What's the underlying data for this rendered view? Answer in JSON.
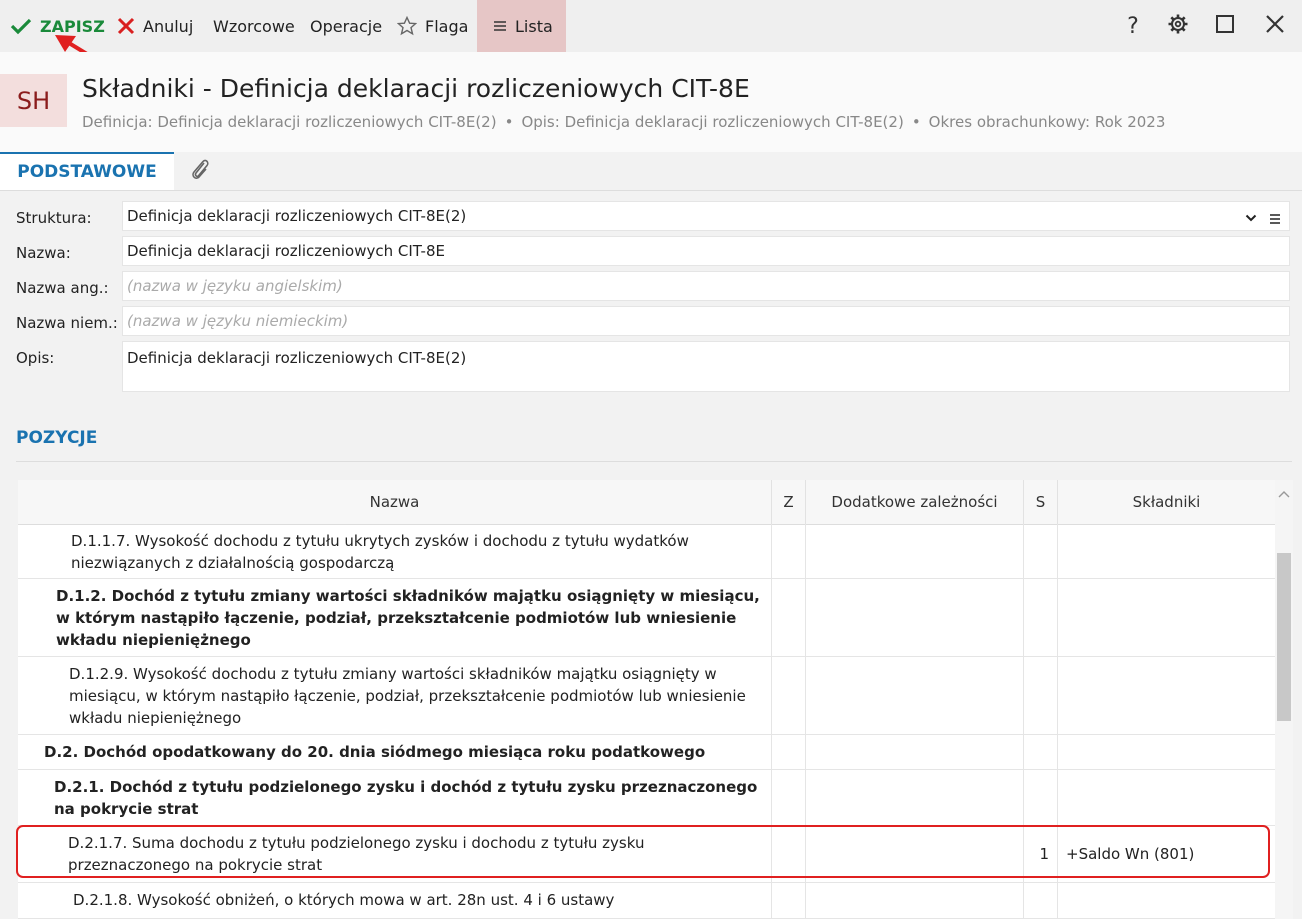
{
  "toolbar": {
    "save_label": "ZAPISZ",
    "cancel_label": "Anuluj",
    "templates_label": "Wzorcowe",
    "operations_label": "Operacje",
    "flag_label": "Flaga",
    "list_label": "Lista",
    "help_label": "?"
  },
  "header": {
    "avatar_text": "SH",
    "title": "Składniki - Definicja deklaracji rozliczeniowych CIT-8E",
    "subtitle": {
      "definition": "Definicja: Definicja deklaracji rozliczeniowych CIT-8E(2)",
      "description": "Opis: Definicja deklaracji rozliczeniowych CIT-8E(2)",
      "period": "Okres obrachunkowy: Rok 2023",
      "separator": "•"
    }
  },
  "tabs": {
    "main": "PODSTAWOWE"
  },
  "form": {
    "structure": {
      "label": "Struktura:",
      "value": "Definicja deklaracji rozliczeniowych CIT-8E(2)"
    },
    "name": {
      "label": "Nazwa:",
      "value": "Definicja deklaracji rozliczeniowych CIT-8E"
    },
    "name_en": {
      "label": "Nazwa ang.:",
      "placeholder": "(nazwa w języku angielskim)"
    },
    "name_de": {
      "label": "Nazwa niem.:",
      "placeholder": "(nazwa w języku niemieckim)"
    },
    "description": {
      "label": "Opis:",
      "value": "Definicja deklaracji rozliczeniowych CIT-8E(2)"
    }
  },
  "positions": {
    "title": "POZYCJE",
    "columns": [
      "Nazwa",
      "Z",
      "Dodatkowe zależności",
      "S",
      "Składniki"
    ],
    "rows": [
      {
        "name": "D.1.1.7. Wysokość dochodu z tytułu ukrytych zysków i dochodu z tytułu wydatków niezwiązanych z działalnością gospodarczą",
        "bold": false,
        "indent": 2,
        "s": "",
        "components": ""
      },
      {
        "name": "D.1.2. Dochód z tytułu zmiany wartości składników majątku osiągnięty w miesiącu, w którym nastąpiło łączenie, podział, przekształcenie podmiotów lub wniesienie wkładu niepieniężnego",
        "bold": true,
        "indent": 1,
        "s": "",
        "components": ""
      },
      {
        "name": "D.1.2.9. Wysokość dochodu z tytułu zmiany wartości składników majątku osiągnięty w miesiącu, w którym nastąpiło łączenie, podział, przekształcenie podmiotów lub wniesienie wkładu niepieniężnego",
        "bold": false,
        "indent": 2,
        "s": "",
        "components": ""
      },
      {
        "name": "D.2. Dochód opodatkowany do 20. dnia siódmego miesiąca roku podatkowego",
        "bold": true,
        "indent": 0,
        "s": "",
        "components": ""
      },
      {
        "name": "D.2.1. Dochód z tytułu podzielonego zysku i dochód z tytułu zysku przeznaczonego na pokrycie strat",
        "bold": true,
        "indent": 1,
        "s": "",
        "components": ""
      },
      {
        "name": "D.2.1.7. Suma dochodu z tytułu podzielonego zysku i dochodu z tytułu zysku przeznaczonego na pokrycie strat",
        "bold": false,
        "indent": 2,
        "s": "1",
        "components": "+Saldo Wn (801)"
      },
      {
        "name": "D.2.1.8. Wysokość obniżeń, o których mowa w art. 28n ust. 4 i 6 ustawy",
        "bold": false,
        "indent": 2,
        "s": "",
        "components": ""
      }
    ]
  }
}
